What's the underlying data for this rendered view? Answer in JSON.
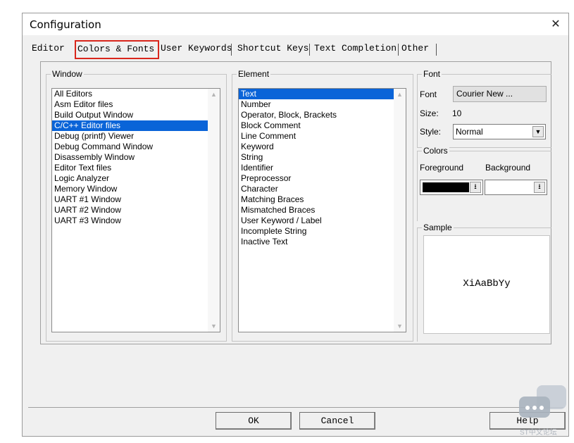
{
  "window": {
    "title": "Configuration"
  },
  "tabs": [
    "Editor",
    "Colors & Fonts",
    "User Keywords",
    "Shortcut Keys",
    "Text Completion",
    "Other"
  ],
  "window_group": {
    "label": "Window",
    "items": [
      "All Editors",
      "Asm Editor files",
      "Build Output Window",
      "C/C++ Editor files",
      "Debug (printf) Viewer",
      "Debug Command Window",
      "Disassembly Window",
      "Editor Text files",
      "Logic Analyzer",
      "Memory Window",
      "UART #1 Window",
      "UART #2 Window",
      "UART #3 Window"
    ],
    "selected_index": 3
  },
  "element_group": {
    "label": "Element",
    "items": [
      "Text",
      "Number",
      "Operator, Block, Brackets",
      "Block Comment",
      "Line Comment",
      "Keyword",
      "String",
      "Identifier",
      "Preprocessor",
      "Character",
      "Matching Braces",
      "Mismatched Braces",
      "User Keyword / Label",
      "Incomplete String",
      "Inactive Text"
    ],
    "selected_index": 0
  },
  "font_group": {
    "label": "Font",
    "font_label": "Font",
    "font_button": "Courier New ...",
    "size_label": "Size:",
    "size_value": "10",
    "style_label": "Style:",
    "style_value": "Normal"
  },
  "colors_group": {
    "label": "Colors",
    "foreground_label": "Foreground",
    "background_label": "Background",
    "foreground_color": "#000000",
    "background_color": "#ffffff"
  },
  "sample_group": {
    "label": "Sample",
    "text": "XiAaBbYy"
  },
  "buttons": {
    "ok": "OK",
    "cancel": "Cancel",
    "help": "Help"
  },
  "watermark": {
    "text": "ST中文论坛"
  },
  "colors": {
    "selection": "#0a64d8",
    "tab_highlight": "#d9261c"
  }
}
